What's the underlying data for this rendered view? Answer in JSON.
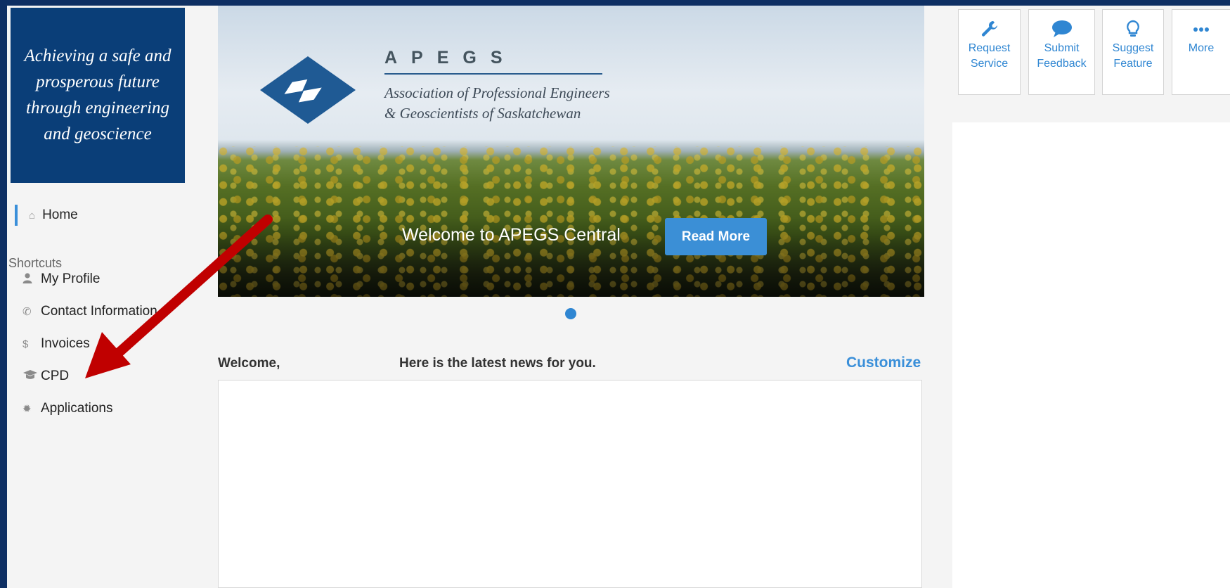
{
  "sidebar": {
    "tagline_lines": [
      "Achieving a safe and",
      "prosperous future",
      "through engineering",
      "and geoscience"
    ],
    "home_label": "Home",
    "shortcuts_heading": "Shortcuts",
    "shortcuts": [
      {
        "label": "My Profile",
        "icon": "user-icon"
      },
      {
        "label": "Contact Information",
        "icon": "phone-icon"
      },
      {
        "label": "Invoices",
        "icon": "dollar-icon"
      },
      {
        "label": "CPD",
        "icon": "graduation-cap-icon"
      },
      {
        "label": "Applications",
        "icon": "gear-icon"
      }
    ]
  },
  "hero": {
    "brand_name": "APEGS",
    "brand_sub_line1": "Association of Professional Engineers",
    "brand_sub_line2": "& Geoscientists of Saskatchewan",
    "caption": "Welcome to APEGS Central",
    "button_label": "Read More"
  },
  "news": {
    "welcome": "Welcome,",
    "subtitle": "Here is the latest news for you.",
    "customize": "Customize"
  },
  "quick_actions": [
    {
      "line1": "Request",
      "line2": "Service",
      "icon": "wrench-icon"
    },
    {
      "line1": "Submit",
      "line2": "Feedback",
      "icon": "speech-bubble-icon"
    },
    {
      "line1": "Suggest",
      "line2": "Feature",
      "icon": "lightbulb-icon"
    },
    {
      "line1": "More",
      "line2": "",
      "icon": "ellipsis-icon"
    }
  ],
  "colors": {
    "frame": "#0e2f63",
    "tagline_bg": "#0a3e78",
    "accent": "#3a8fd9",
    "annotation_arrow": "#c00000"
  }
}
